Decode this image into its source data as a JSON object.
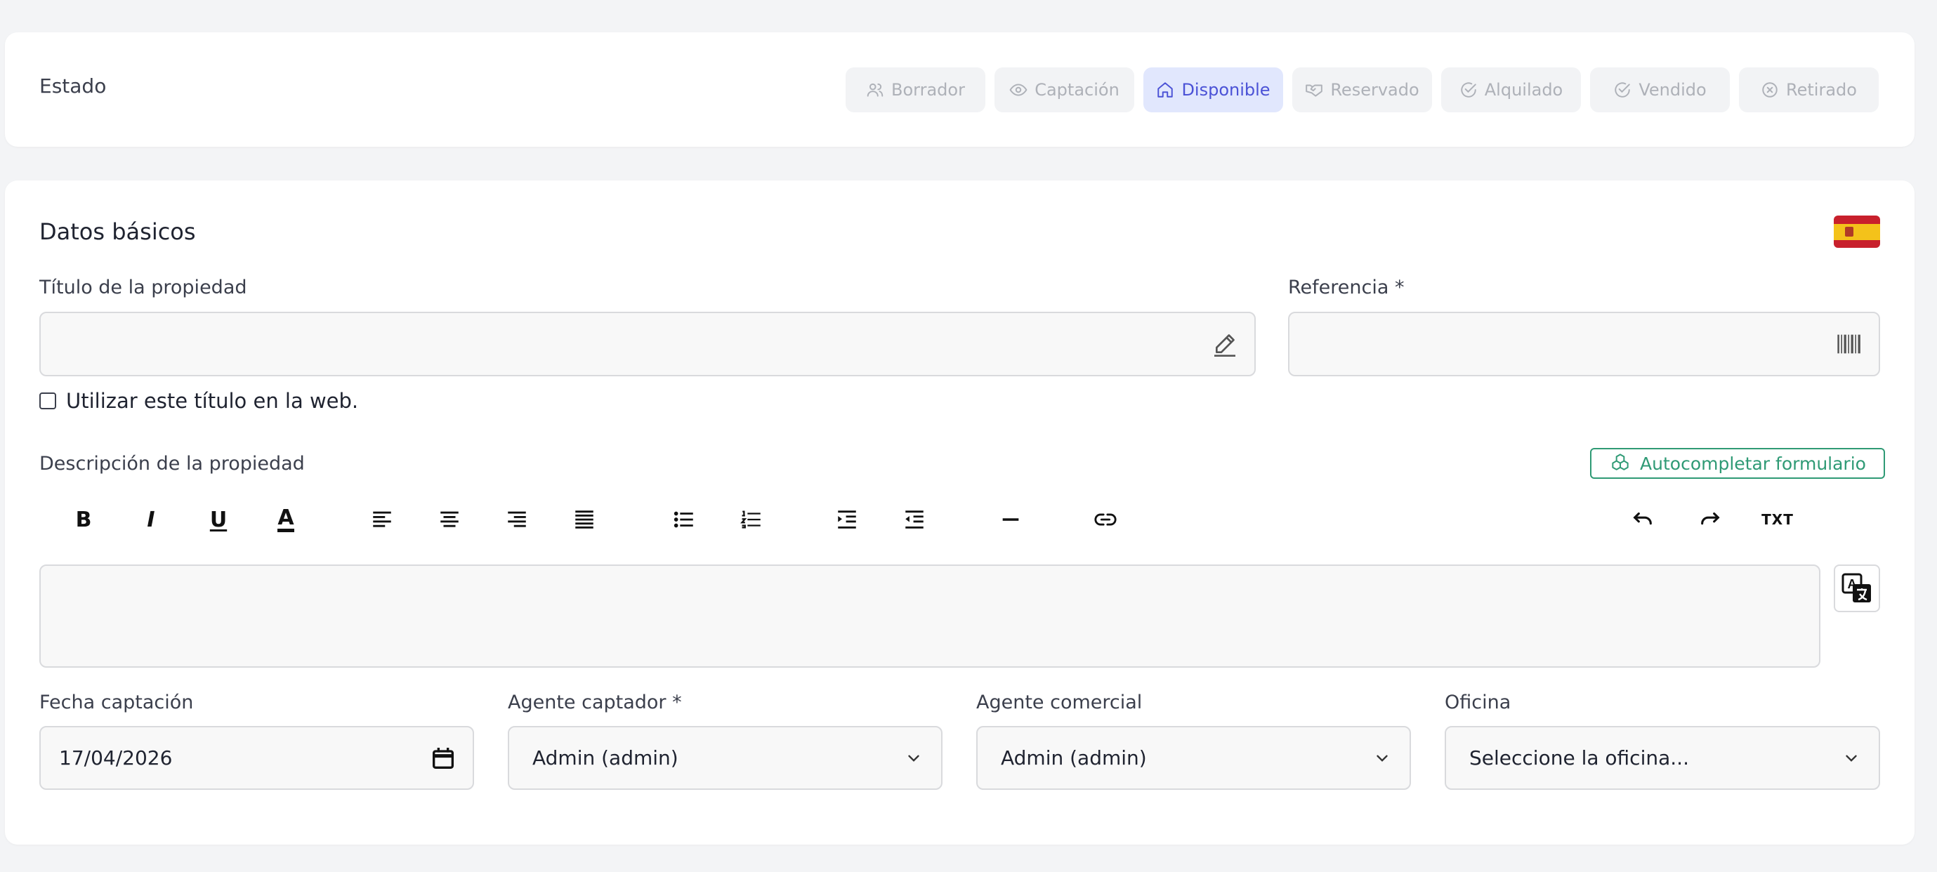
{
  "estado": {
    "title": "Estado",
    "statuses": [
      {
        "label": "Borrador",
        "icon": "users-icon",
        "active": false
      },
      {
        "label": "Captación",
        "icon": "eye-icon",
        "active": false
      },
      {
        "label": "Disponible",
        "icon": "home-icon",
        "active": true
      },
      {
        "label": "Reservado",
        "icon": "handshake-icon",
        "active": false
      },
      {
        "label": "Alquilado",
        "icon": "check-circle-icon",
        "active": false
      },
      {
        "label": "Vendido",
        "icon": "check-circle-icon",
        "active": false
      },
      {
        "label": "Retirado",
        "icon": "x-circle-icon",
        "active": false
      }
    ],
    "active_color": "#4b52d6",
    "active_bg": "#e1e7fd"
  },
  "basic": {
    "title": "Datos básicos",
    "language_flag": "spain-flag-icon",
    "title_field": {
      "label": "Título de la propiedad",
      "value": "",
      "icon": "pencil-icon"
    },
    "reference_field": {
      "label": "Referencia *",
      "value": "",
      "icon": "barcode-icon"
    },
    "use_title_checkbox": {
      "label": "Utilizar este título en la web.",
      "checked": false
    },
    "description": {
      "label": "Descripción de la propiedad",
      "autocomplete_label": "Autocompletar formulario",
      "autocomplete_color": "#2f9a75",
      "value": "",
      "toolbar": {
        "bold": "B",
        "italic": "I",
        "underline": "U",
        "text_color": "A",
        "txt": "TXT"
      }
    },
    "fecha_captacion": {
      "label": "Fecha captación",
      "value": "17/04/2026"
    },
    "agente_captador": {
      "label": "Agente captador *",
      "value": "Admin (admin)"
    },
    "agente_comercial": {
      "label": "Agente comercial",
      "value": "Admin (admin)"
    },
    "oficina": {
      "label": "Oficina",
      "value": "Seleccione la oficina..."
    }
  }
}
